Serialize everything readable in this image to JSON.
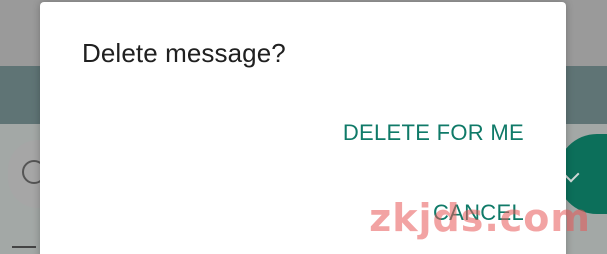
{
  "dialog": {
    "title": "Delete message?",
    "actions": {
      "delete_for_me": "DELETE FOR ME",
      "cancel": "CANCEL"
    }
  },
  "watermark": "zkjds.com",
  "colors": {
    "accent": "#0f7a68",
    "dialog_bg": "#ffffff",
    "title_text": "#202020",
    "scrim": "#9a9a9a",
    "send_button": "#0c6f5a"
  },
  "icons": {
    "emoji": "emoji-icon",
    "send_chevron": "chevron-down-icon"
  }
}
